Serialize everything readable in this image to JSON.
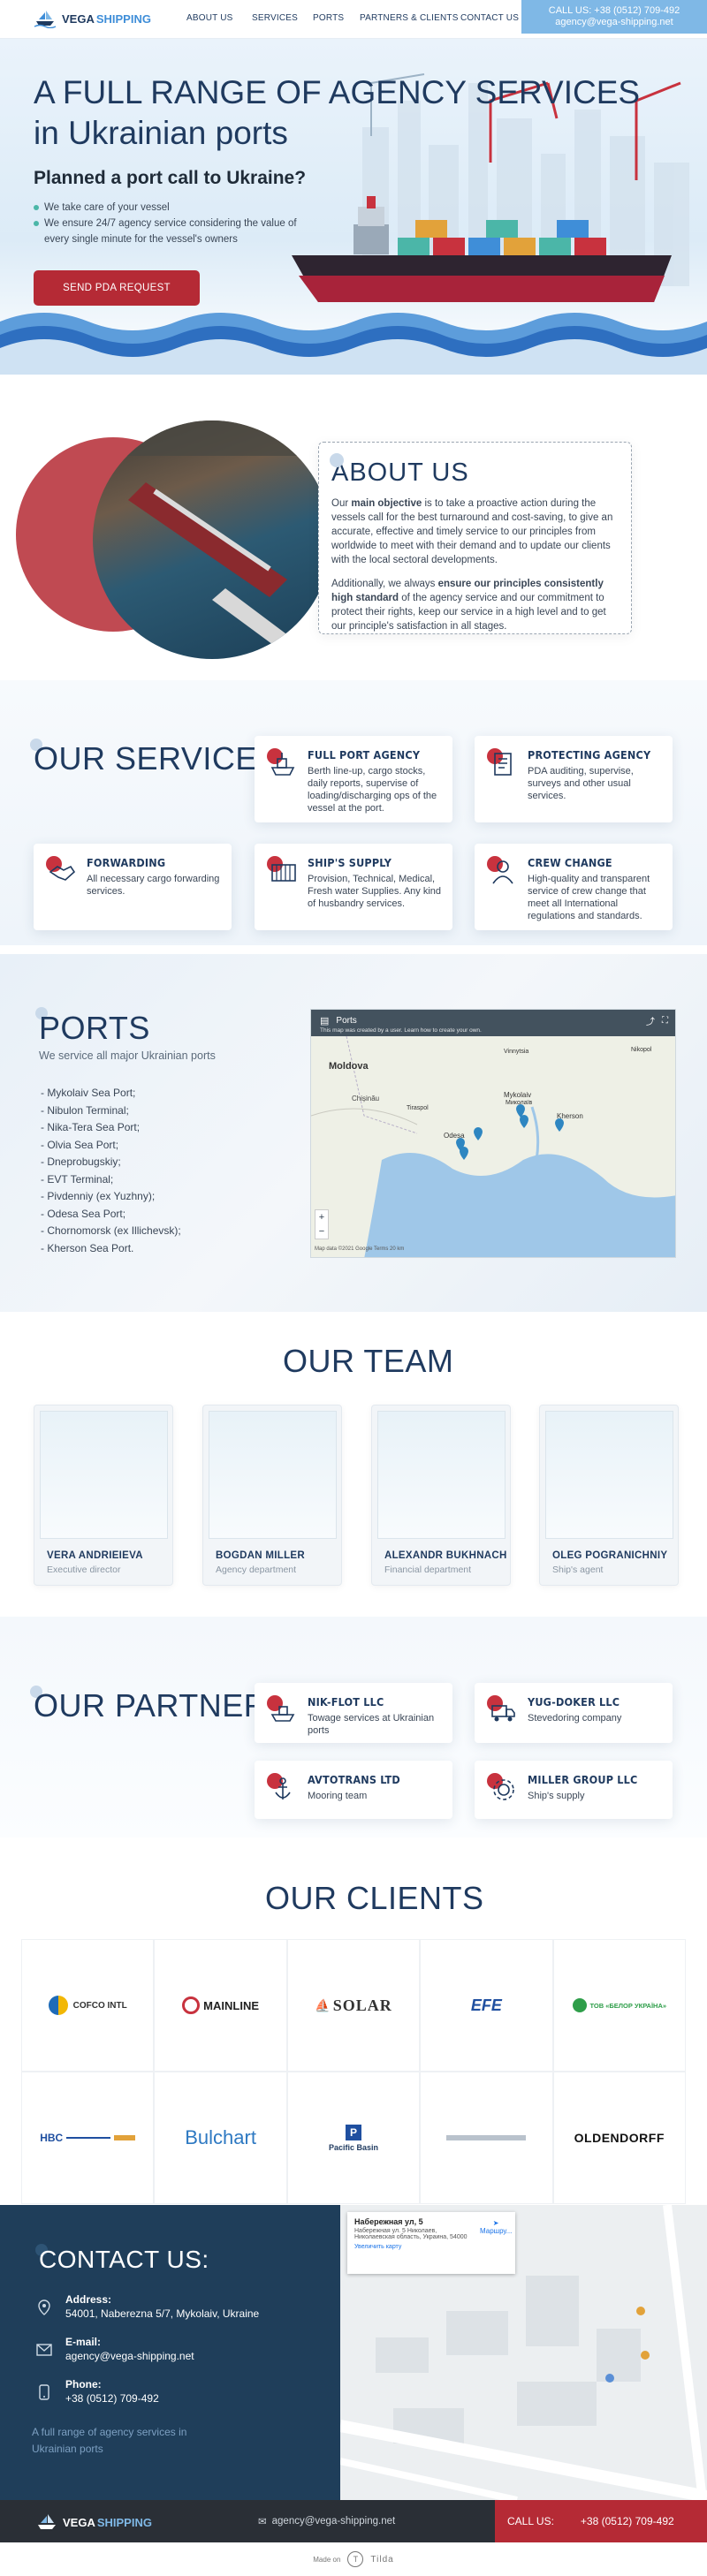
{
  "header": {
    "logo_part1": "VEGA",
    "logo_part2": "SHIPPING",
    "nav": [
      "ABOUT US",
      "SERVICES",
      "PORTS",
      "PARTNERS & CLIENTS",
      "CONTACT US"
    ],
    "call_label": "CALL US: +38 (0512) 709-492",
    "call_email": "agency@vega-shipping.net"
  },
  "hero": {
    "title_line1": "A FULL RANGE OF AGENCY SERVICES",
    "title_line2": "in Ukrainian ports",
    "subtitle": "Planned a port call to Ukraine?",
    "bullets": [
      "We take care of your vessel",
      "We ensure 24/7 agency service considering the value of every single minute for the vessel's owners"
    ],
    "button": "SEND PDA REQUEST"
  },
  "about": {
    "title": "ABOUT US",
    "p1_a": "Our ",
    "p1_b": "main objective",
    "p1_c": " is to take a proactive action during the vessels call for the best turnaround and cost-saving, to give an accurate, effective and timely service to our principles from worldwide to meet with their demand and to update our clients with the local sectoral developments.",
    "p2_a": "Additionally, we always ",
    "p2_b": "ensure our principles consistently high standard",
    "p2_c": " of the agency service and our commitment to protect their rights, keep our service in a high level and to get our principle's satisfaction in all stages."
  },
  "services": {
    "title": "OUR SERVICES",
    "items": [
      {
        "title": "FULL PORT AGENCY",
        "desc": "Berth line-up, cargo stocks, daily reports, supervise of loading/discharging ops of the vessel at the port.",
        "icon": "ship-icon"
      },
      {
        "title": "PROTECTING AGENCY",
        "desc": "PDA auditing, supervise, surveys and other usual services.",
        "icon": "document-icon"
      },
      {
        "title": "FORWARDING",
        "desc": "All necessary cargo forwarding services.",
        "icon": "handshake-icon"
      },
      {
        "title": "SHIP'S SUPPLY",
        "desc": "Provision, Technical, Medical, Fresh water Supplies. Any kind of husbandry services.",
        "icon": "container-icon"
      },
      {
        "title": "CREW CHANGE",
        "desc": "High-quality and transparent service of crew change that meet all International regulations and standards.",
        "icon": "crew-icon"
      }
    ]
  },
  "ports": {
    "title": "PORTS",
    "subtitle": "We service all major Ukrainian ports",
    "list": [
      "- Mykolaiv Sea Port;",
      "- Nibulon Terminal;",
      "- Nika-Tera Sea Port;",
      "- Olvia Sea Port;",
      "- Dneprobugskiy;",
      "- EVT Terminal;",
      "- Pivdenniy (ex Yuzhny);",
      "- Odesa Sea Port;",
      "- Chornomorsk (ex Illichevsk);",
      "- Kherson Sea Port."
    ],
    "map": {
      "title": "Ports",
      "notice": "This map was created by a user. Learn how to create your own.",
      "labels": [
        "Moldova",
        "Chișinău",
        "Mykolaiv",
        "Миколаїв",
        "Kherson",
        "Odesa",
        "Vinnytsia",
        "Nikopol",
        "Tiraspol"
      ],
      "footer": "Map data ©2021 Google  Terms  20 km"
    }
  },
  "team": {
    "title": "OUR TEAM",
    "members": [
      {
        "name": "VERA ANDRIEIEVA",
        "role": "Executive director"
      },
      {
        "name": "BOGDAN MILLER",
        "role": "Agency department"
      },
      {
        "name": "ALEXANDR BUKHNACH",
        "role": "Financial department"
      },
      {
        "name": "OLEG POGRANICHNIY",
        "role": "Ship's agent"
      }
    ]
  },
  "partners": {
    "title": "OUR PARTNERS",
    "items": [
      {
        "title": "NIK-FLOT LLC",
        "desc": "Towage services at Ukrainian ports",
        "icon": "tugboat-icon"
      },
      {
        "title": "YUG-DOKER LLC",
        "desc": "Stevedoring company",
        "icon": "truck-icon"
      },
      {
        "title": "AVTOTRANS LTD",
        "desc": "Mooring team",
        "icon": "anchor-icon"
      },
      {
        "title": "MILLER GROUP LLC",
        "desc": "Ship's supply",
        "icon": "gear-icon"
      }
    ]
  },
  "clients": {
    "title": "OUR CLIENTS",
    "logos": [
      "COFCO INTL",
      "MAINLINE",
      "SOLAR",
      "EFE",
      "ТОВ «БЕЛОР УКРАЇНА»",
      "HBC",
      "Bulchart",
      "Pacific Basin",
      "logo-9",
      "OLDENDORFF"
    ]
  },
  "contact": {
    "title": "CONTACT US:",
    "address_label": "Address:",
    "address": "54001, Naberezna 5/7, Mykolaiv, Ukraine",
    "email_label": "E-mail:",
    "email": "agency@vega-shipping.net",
    "phone_label": "Phone:",
    "phone": "+38 (0512) 709-492",
    "tagline": "A full range of agency services in Ukrainian ports",
    "map": {
      "addr_title": "Набережная ул, 5",
      "addr_detail": "Набережная ул. 5 Николаев, Николаевская область, Украина, 54000",
      "link": "Увеличить карту",
      "route": "Маршру..."
    }
  },
  "footer": {
    "logo_part1": "VEGA",
    "logo_part2": "SHIPPING",
    "email": "agency@vega-shipping.net",
    "call_label": "CALL US:",
    "phone": "+38 (0512) 709-492",
    "made_on": "Made on",
    "tilda": "Tilda"
  },
  "colors": {
    "navy": "#1f3a5f",
    "accent_red": "#c8323e",
    "light_blue": "#7fb8e6",
    "footer": "#2a2f36"
  }
}
